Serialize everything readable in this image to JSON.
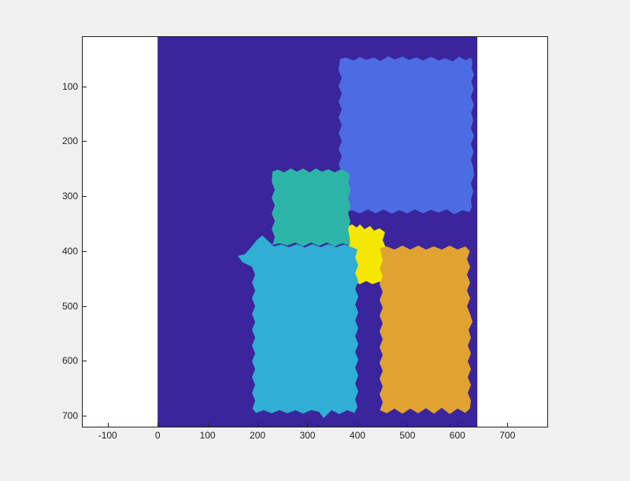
{
  "chart_data": {
    "type": "heatmap",
    "title": "",
    "xlabel": "",
    "ylabel": "",
    "xlim": [
      -150,
      780
    ],
    "ylim": [
      720,
      10
    ],
    "x_ticks": [
      -100,
      0,
      100,
      200,
      300,
      400,
      500,
      600,
      700
    ],
    "y_ticks": [
      100,
      200,
      300,
      400,
      500,
      600,
      700
    ],
    "image_extent": {
      "xmin": 0,
      "xmax": 640,
      "ymin": 0,
      "ymax": 720
    },
    "colormap_name": "parula",
    "background_label": 0,
    "regions": [
      {
        "label": 1,
        "color": "#4b6ce3",
        "approx_bbox": {
          "xmin": 365,
          "xmax": 630,
          "ymin": 50,
          "ymax": 330
        }
      },
      {
        "label": 2,
        "color": "#2db6a7",
        "approx_bbox": {
          "xmin": 230,
          "xmax": 385,
          "ymin": 255,
          "ymax": 390
        }
      },
      {
        "label": 3,
        "color": "#30aed4",
        "approx_bbox": {
          "xmin": 190,
          "xmax": 400,
          "ymin": 390,
          "ymax": 695
        }
      },
      {
        "label": 4,
        "color": "#f4e700",
        "approx_bbox": {
          "xmin": 380,
          "xmax": 455,
          "ymin": 355,
          "ymax": 460
        }
      },
      {
        "label": 5,
        "color": "#e0a332",
        "approx_bbox": {
          "xmin": 445,
          "xmax": 625,
          "ymin": 395,
          "ymax": 695
        }
      }
    ],
    "background_color": "#3a259c"
  }
}
